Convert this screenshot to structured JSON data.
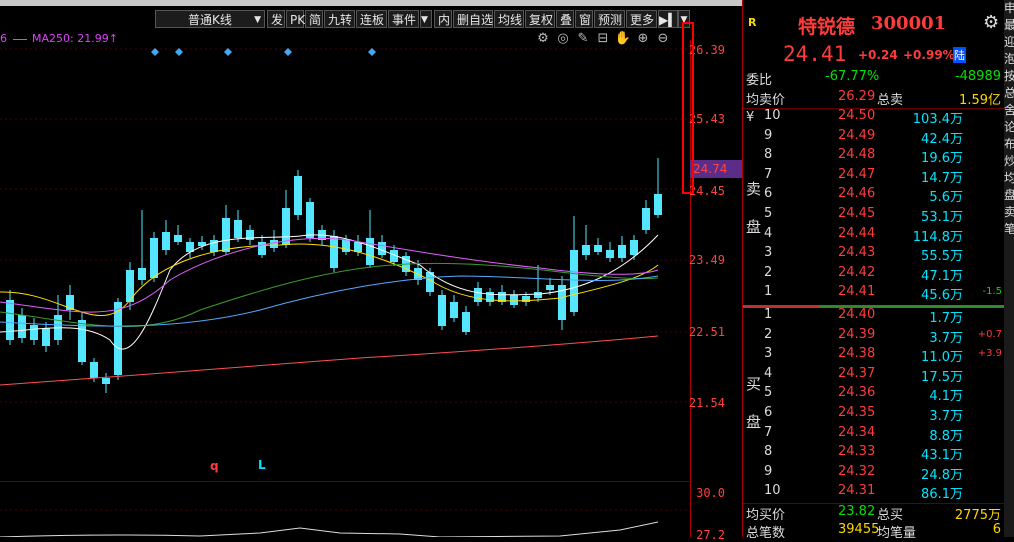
{
  "toolbar": {
    "chart_type": "普通K线",
    "buttons": [
      "发",
      "PK",
      "简",
      "九转",
      "连板",
      "事件"
    ],
    "buttons2": [
      "内",
      "删自选",
      "均线",
      "复权",
      "叠",
      "窗",
      "预测",
      "更多"
    ]
  },
  "ma_label": "MA250: 21.99↑",
  "ma_prefix": "6",
  "price_axis": [
    "26.39",
    "25.43",
    "24.45",
    "23.49",
    "22.51",
    "21.54",
    "30.0",
    "27.2"
  ],
  "current_price_tag": "24.74",
  "markers": {
    "q": "q",
    "L": "L"
  },
  "stock": {
    "r_label": "R",
    "name": "特锐德",
    "code": "300001",
    "price": "24.41",
    "change": "+0.24",
    "change_pct": "+0.99%",
    "badge": "陆"
  },
  "committee": {
    "label": "委比",
    "pct": "-67.77%",
    "diff": "-48989"
  },
  "avg_sell": {
    "label": "均卖价",
    "value": "26.29",
    "total_label": "总卖",
    "total": "1.59亿"
  },
  "sell_side_label": [
    "卖",
    "盘"
  ],
  "buy_side_label": [
    "买",
    "盘"
  ],
  "sell": [
    {
      "n": "10",
      "price": "24.50",
      "vol": "103.4万",
      "extra": ""
    },
    {
      "n": "9",
      "price": "24.49",
      "vol": "42.4万",
      "extra": ""
    },
    {
      "n": "8",
      "price": "24.48",
      "vol": "19.6万",
      "extra": ""
    },
    {
      "n": "7",
      "price": "24.47",
      "vol": "14.7万",
      "extra": ""
    },
    {
      "n": "6",
      "price": "24.46",
      "vol": "5.6万",
      "extra": ""
    },
    {
      "n": "5",
      "price": "24.45",
      "vol": "53.1万",
      "extra": ""
    },
    {
      "n": "4",
      "price": "24.44",
      "vol": "114.8万",
      "extra": ""
    },
    {
      "n": "3",
      "price": "24.43",
      "vol": "55.5万",
      "extra": ""
    },
    {
      "n": "2",
      "price": "24.42",
      "vol": "47.1万",
      "extra": ""
    },
    {
      "n": "1",
      "price": "24.41",
      "vol": "45.6万",
      "extra": "-1.5"
    }
  ],
  "sell_prefix": "¥",
  "buy": [
    {
      "n": "1",
      "price": "24.40",
      "vol": "1.7万",
      "extra": ""
    },
    {
      "n": "2",
      "price": "24.39",
      "vol": "3.7万",
      "extra": "+0.7"
    },
    {
      "n": "3",
      "price": "24.38",
      "vol": "11.0万",
      "extra": "+3.9"
    },
    {
      "n": "4",
      "price": "24.37",
      "vol": "17.5万",
      "extra": ""
    },
    {
      "n": "5",
      "price": "24.36",
      "vol": "4.1万",
      "extra": ""
    },
    {
      "n": "6",
      "price": "24.35",
      "vol": "3.7万",
      "extra": ""
    },
    {
      "n": "7",
      "price": "24.34",
      "vol": "8.8万",
      "extra": ""
    },
    {
      "n": "8",
      "price": "24.33",
      "vol": "43.1万",
      "extra": ""
    },
    {
      "n": "9",
      "price": "24.32",
      "vol": "24.8万",
      "extra": ""
    },
    {
      "n": "10",
      "price": "24.31",
      "vol": "86.1万",
      "extra": ""
    }
  ],
  "avg_buy": {
    "label": "均买价",
    "value": "23.82",
    "total_label": "总买",
    "total": "2775万"
  },
  "total_trades": {
    "label": "总笔数",
    "value": "39455",
    "avg_label": "均笔量",
    "avg": "6"
  },
  "right_strip": [
    "申",
    "最",
    "迎",
    "泡",
    "按",
    "总",
    "舍",
    "论",
    "布",
    "炒",
    "均",
    "盘",
    "卖",
    "笔"
  ]
}
